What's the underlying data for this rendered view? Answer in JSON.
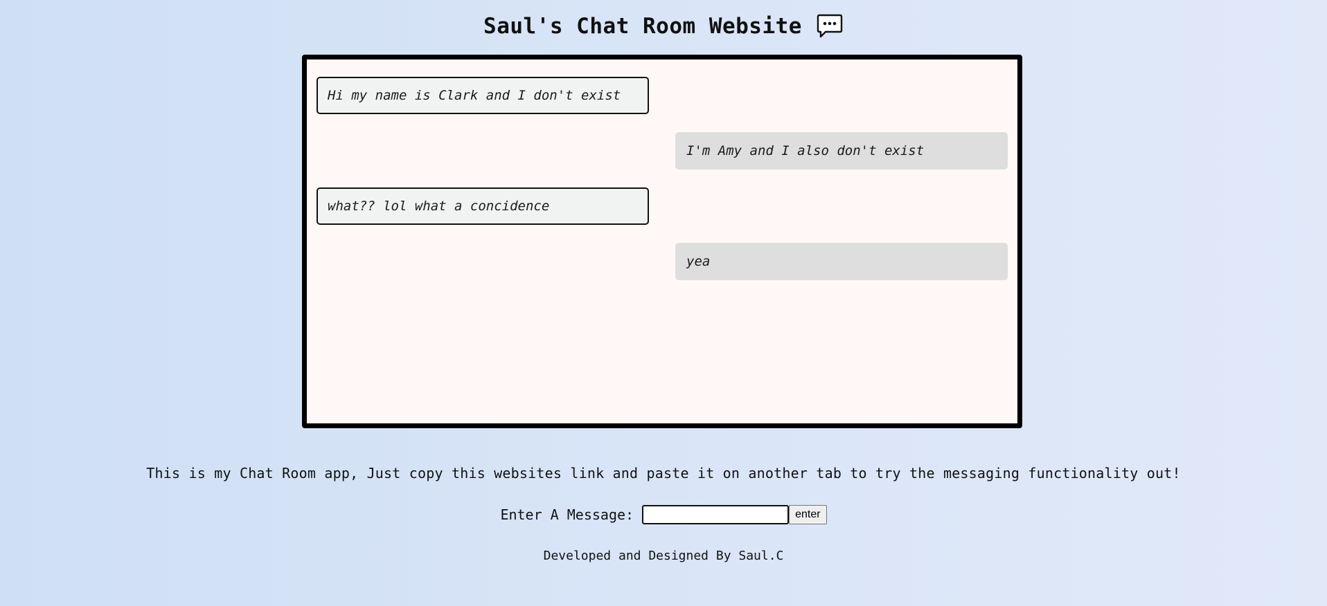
{
  "header": {
    "title": "Saul's Chat Room Website",
    "icon": "speech-bubble-icon"
  },
  "chat": {
    "messages": [
      {
        "text": "Hi my name is Clark and I don't exist",
        "side": "left"
      },
      {
        "text": "I'm Amy and I also don't exist",
        "side": "right"
      },
      {
        "text": "what?? lol what a concidence",
        "side": "left"
      },
      {
        "text": "yea",
        "side": "right"
      }
    ]
  },
  "info": {
    "text": "This is my Chat Room app, Just copy this websites link and paste it on another tab to try the messaging functionality out!"
  },
  "composer": {
    "label": "Enter A Message:",
    "input_value": "",
    "button_label": "enter"
  },
  "footer": {
    "text": "Developed and Designed By Saul.C"
  },
  "colors": {
    "background_start": "#cfdff5",
    "background_end": "#e1e9f9",
    "chat_box_bg": "#fff8f7",
    "left_bubble_bg": "#f1f3f3",
    "right_bubble_bg": "#dedede",
    "border": "#000000"
  }
}
